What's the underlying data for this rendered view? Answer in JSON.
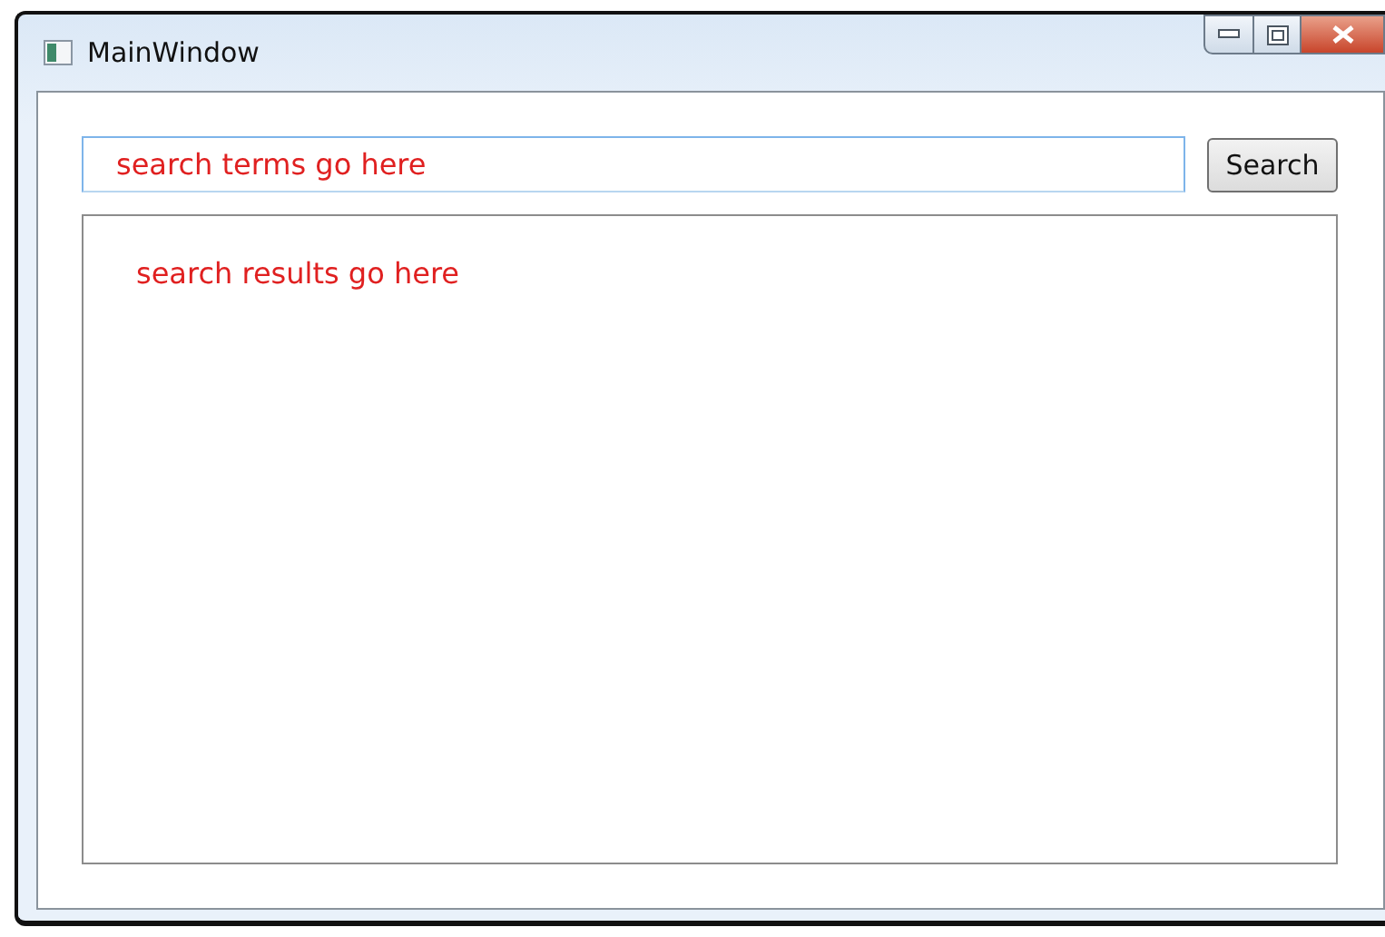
{
  "window": {
    "title": "MainWindow"
  },
  "search": {
    "value": "search terms go here"
  },
  "button": "Search",
  "results": {
    "text": "search results go here"
  }
}
